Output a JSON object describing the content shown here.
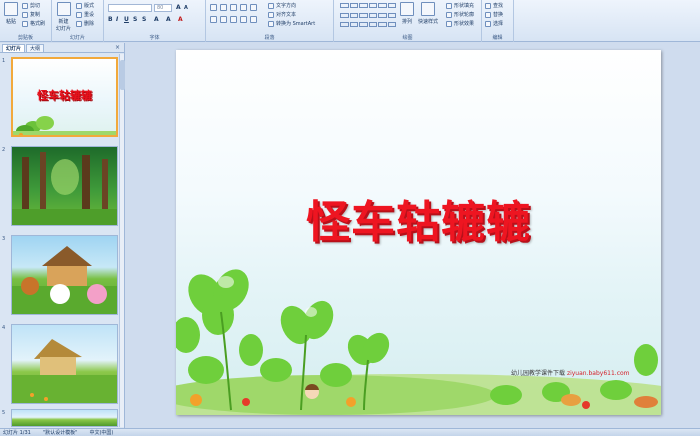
{
  "ribbon": {
    "clipboard": {
      "label": "剪贴板",
      "paste": "粘贴",
      "cut": "剪切",
      "copy": "复制",
      "format_painter": "格式刷"
    },
    "slides": {
      "label": "幻灯片",
      "new_slide": "新建\n幻灯片",
      "layout": "版式",
      "reset": "重设",
      "delete": "删除"
    },
    "font": {
      "label": "字体",
      "font_name": "",
      "font_size": "80"
    },
    "paragraph": {
      "label": "段落",
      "text_direction": "文字方向",
      "align_text": "对齐文本",
      "smartart": "转换为 SmartArt"
    },
    "drawing": {
      "label": "绘图",
      "arrange": "排列",
      "quick_styles": "快速样式",
      "shape_fill": "形状填充",
      "shape_outline": "形状轮廓",
      "shape_effects": "形状效果"
    },
    "editing": {
      "label": "编辑",
      "find": "查找",
      "replace": "替换",
      "select": "选择"
    }
  },
  "panel": {
    "tabs": [
      "幻灯片",
      "大纲"
    ],
    "close": "×",
    "slides": [
      {
        "num": "1",
        "title": "怪车轱辘辘"
      },
      {
        "num": "2"
      },
      {
        "num": "3"
      },
      {
        "num": "4"
      },
      {
        "num": "5"
      }
    ]
  },
  "slide": {
    "title": "怪车轱辘辘",
    "credit_text": "幼儿园教学课件下载",
    "credit_url": "ziyuan.baby611.com"
  },
  "status": {
    "slide_count": "幻灯片 1/31",
    "theme": "\"默认设计模板\"",
    "language": "中文(中国)"
  },
  "colors": {
    "title_red": "#ee1521",
    "ribbon_bg": "#d7e4f4",
    "selected_thumb": "#f2a93b"
  }
}
